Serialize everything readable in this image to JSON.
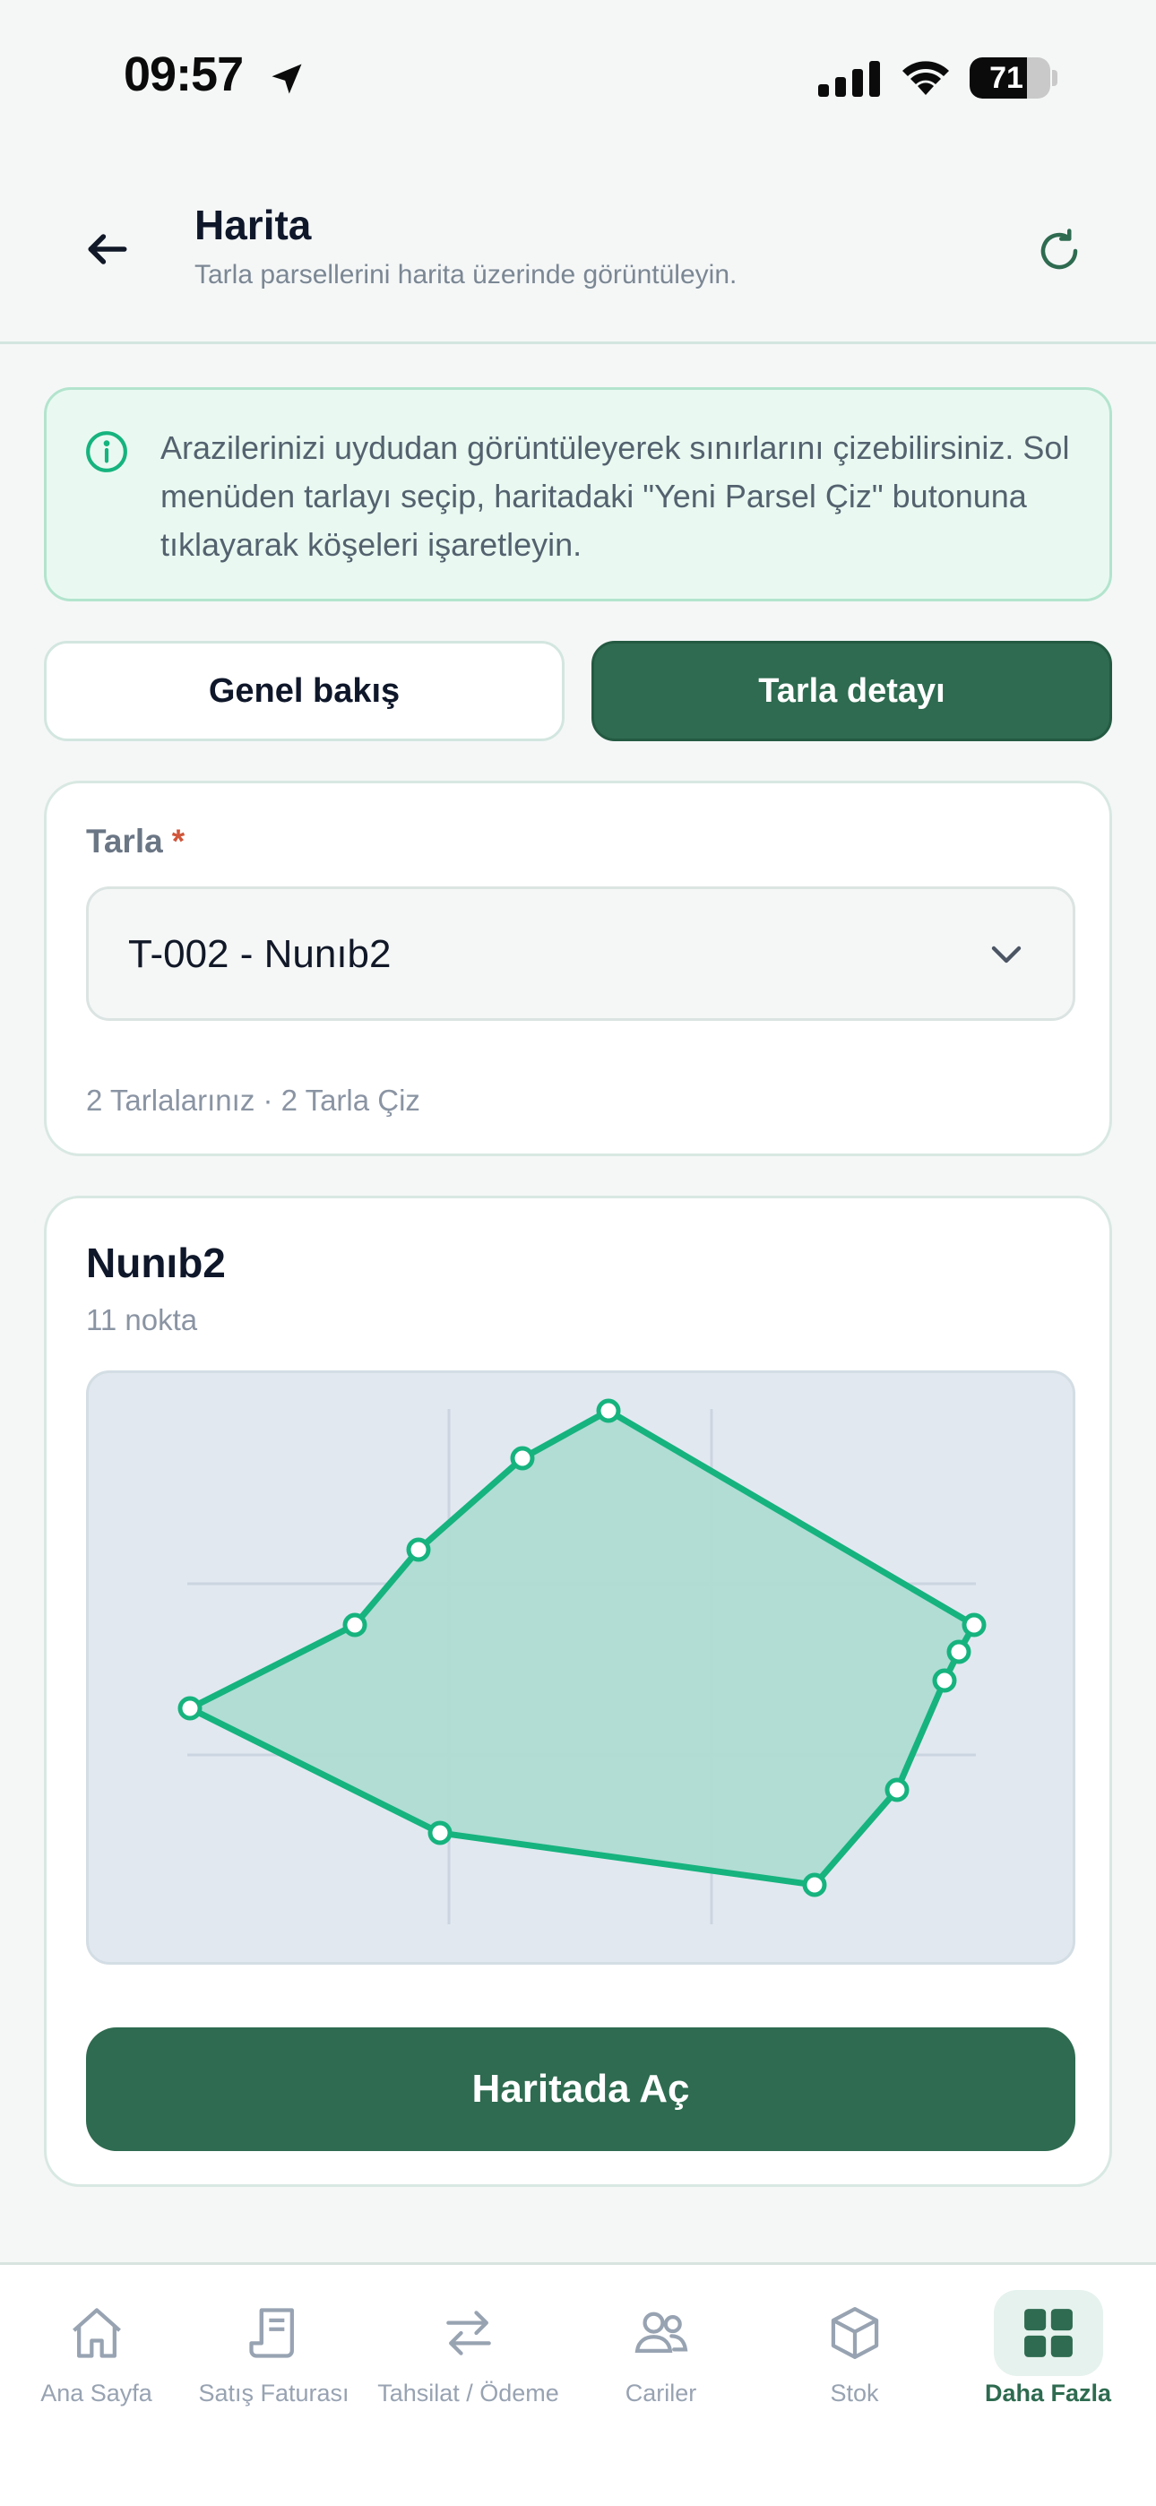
{
  "status_bar": {
    "time": "09:57",
    "battery_percent": 71
  },
  "header": {
    "title": "Harita",
    "subtitle": "Tarla parsellerini harita üzerinde görüntüleyin."
  },
  "info_banner": {
    "text": "Arazilerinizi uydudan görüntüleyerek sınırlarını çizebilirsiniz. Sol menüden tarlayı seçip, haritadaki \"Yeni Parsel Çiz\" butonuna tıklayarak köşeleri işaretleyin."
  },
  "tabs": {
    "overview_label": "Genel bakış",
    "detail_label": "Tarla detayı",
    "active": "detail"
  },
  "field_select": {
    "label": "Tarla",
    "required_mark": "*",
    "value": "T-002 - Nunıb2",
    "meta": "2 Tarlalarınız · 2 Tarla Çiz"
  },
  "parcel": {
    "name": "Nunıb2",
    "point_count_label": "11 nokta",
    "open_button_label": "Haritada Aç"
  },
  "bottom_nav": {
    "items": [
      {
        "label": "Ana Sayfa",
        "icon": "home-icon",
        "active": false
      },
      {
        "label": "Satış Faturası",
        "icon": "receipt-icon",
        "active": false
      },
      {
        "label": "Tahsilat / Ödeme",
        "icon": "transfer-icon",
        "active": false
      },
      {
        "label": "Cariler",
        "icon": "users-icon",
        "active": false
      },
      {
        "label": "Stok",
        "icon": "box-icon",
        "active": false
      },
      {
        "label": "Daha Fazla",
        "icon": "grid-icon",
        "active": true
      }
    ]
  },
  "colors": {
    "primary": "#2e6b50",
    "parcel_stroke": "#16b37e",
    "parcel_fill": "#aedcd2",
    "map_background": "#e2e8f0"
  }
}
